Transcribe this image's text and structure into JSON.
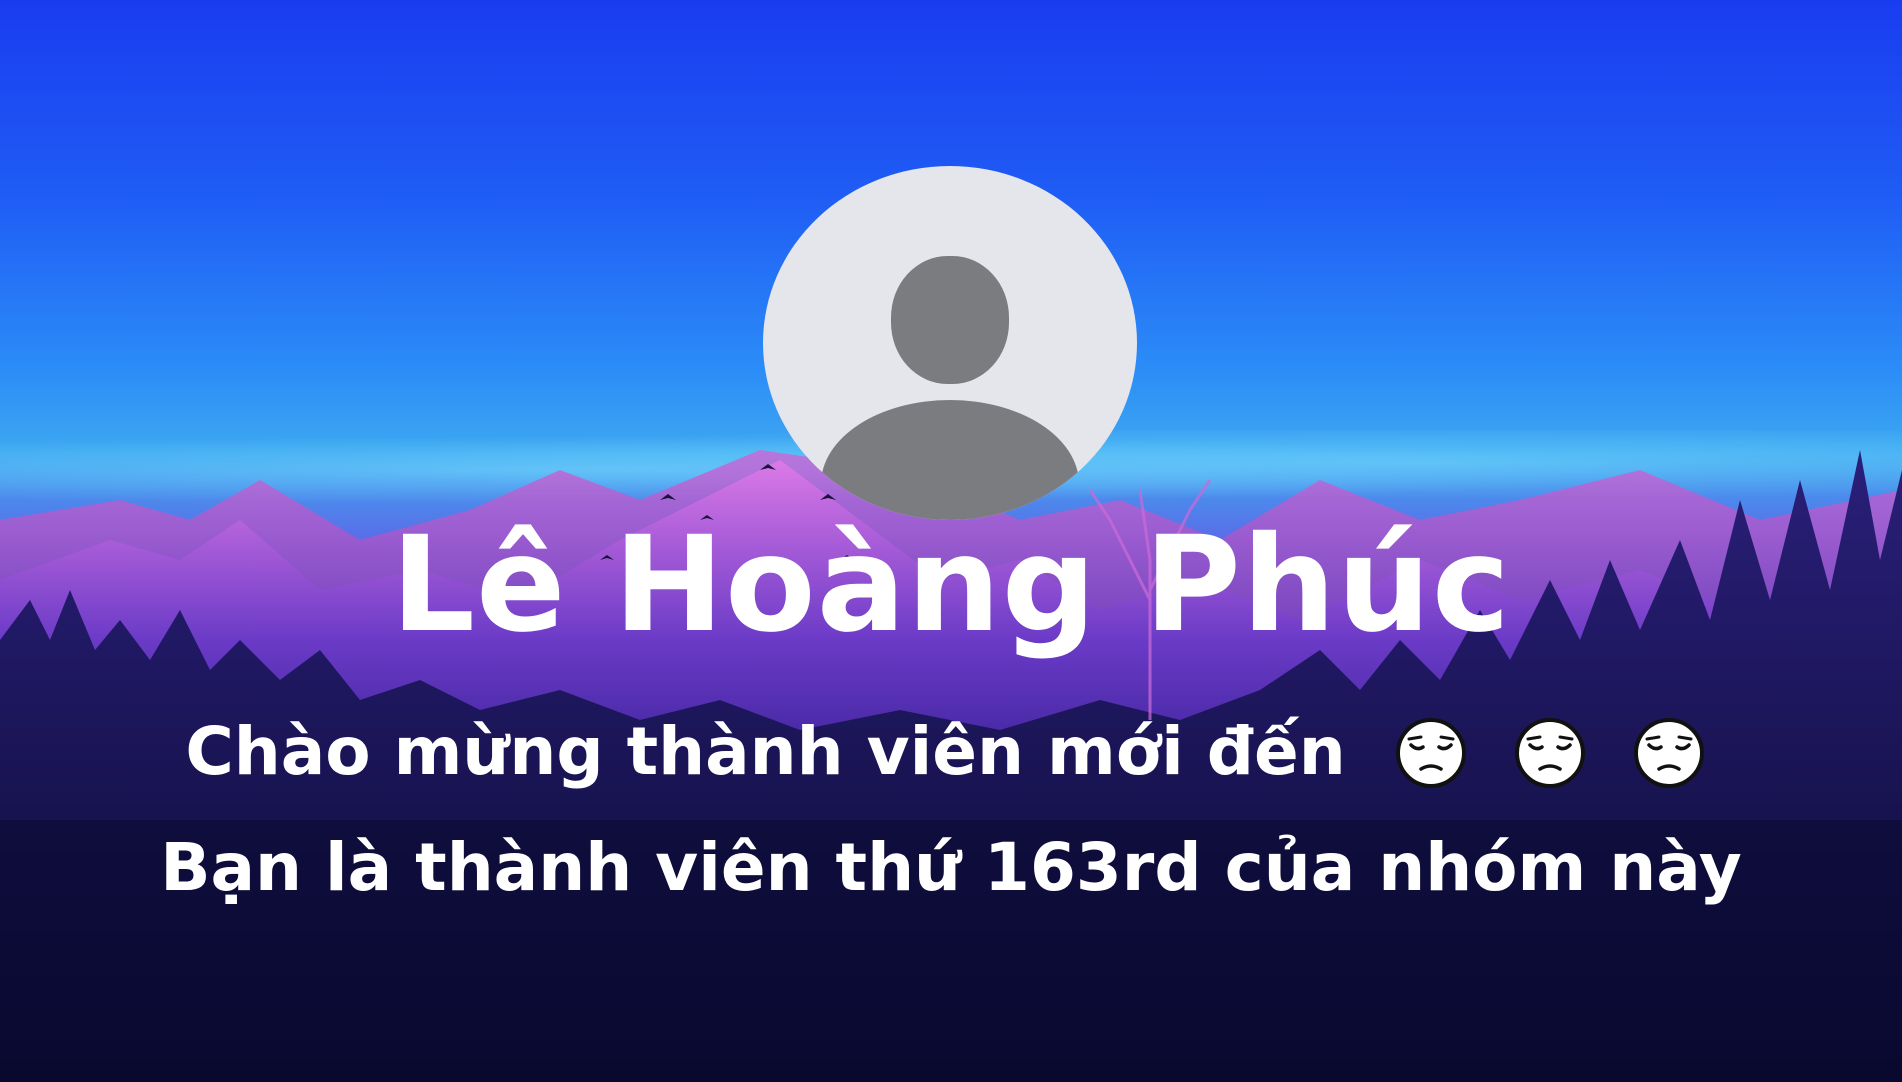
{
  "member": {
    "name": "Lê Hoàng Phúc"
  },
  "welcome": {
    "line1": "Chào mừng thành viên mới đến",
    "line2": "Bạn là thành viên thứ 163rd của nhóm này",
    "emojis": [
      "pensive-face-icon",
      "pensive-face-icon",
      "pensive-face-icon"
    ]
  },
  "avatar": {
    "icon": "default-user-icon",
    "background": "#e4e6eb",
    "silhouette": "#7a7c80"
  },
  "colors": {
    "text": "#ffffff"
  }
}
